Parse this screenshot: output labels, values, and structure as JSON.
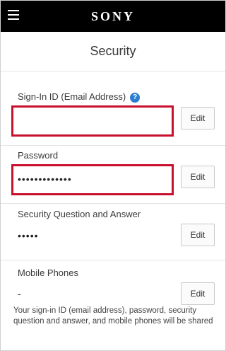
{
  "header": {
    "brand": "SONY",
    "menu_icon": "hamburger-menu-icon"
  },
  "page": {
    "title": "Security"
  },
  "sections": [
    {
      "label": "Sign-In ID (Email Address)",
      "value": "",
      "edit_label": "Edit",
      "has_help": true,
      "help_icon": "help-question-icon",
      "help_glyph": "?"
    },
    {
      "label": "Password",
      "value": "•••••••••••••",
      "edit_label": "Edit"
    },
    {
      "label": "Security Question and Answer",
      "value": "•••••",
      "edit_label": "Edit"
    },
    {
      "label": "Mobile Phones",
      "value": "-",
      "edit_label": "Edit"
    }
  ],
  "footer": {
    "note": "Your sign-in ID (email address), password, security question and answer, and mobile phones will be shared"
  },
  "colors": {
    "topbar": "#000000",
    "highlight_border": "#c8102e",
    "help_icon": "#2b7cd3"
  }
}
